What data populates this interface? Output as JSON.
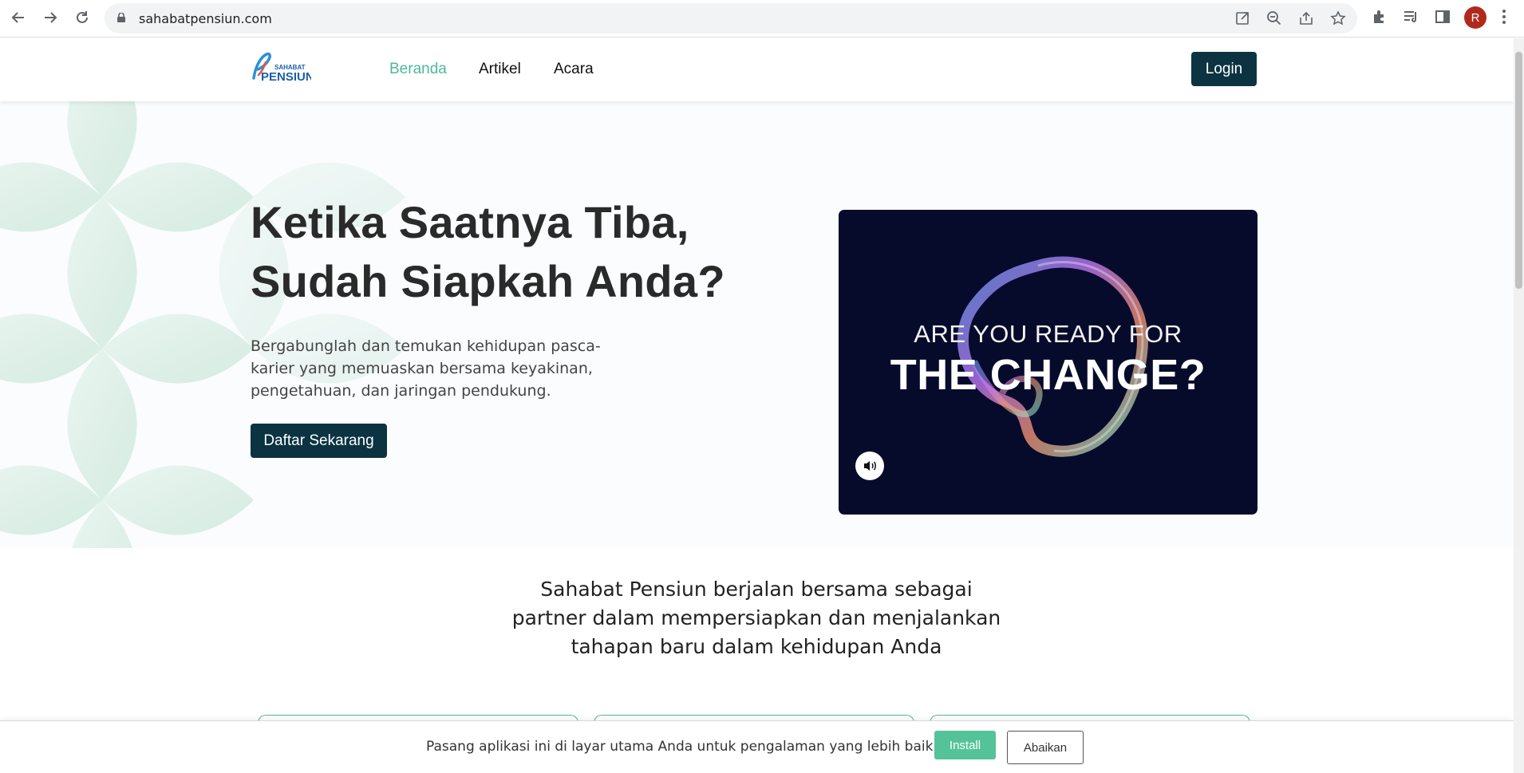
{
  "browser": {
    "url": "sahabatpensiun.com",
    "profile_initial": "R",
    "icons": [
      "back-arrow-icon",
      "forward-arrow-icon",
      "reload-icon",
      "lock-icon",
      "open-in-app-icon",
      "zoom-out-icon",
      "share-icon",
      "bookmark-star-icon",
      "extensions-puzzle-icon",
      "media-queue-icon",
      "side-panel-icon",
      "more-vert-icon"
    ]
  },
  "site": {
    "logo_text_top": "SAHABAT",
    "logo_text_bottom": "PENSIUN",
    "nav": [
      {
        "label": "Beranda",
        "active": true
      },
      {
        "label": "Artikel",
        "active": false
      },
      {
        "label": "Acara",
        "active": false
      }
    ],
    "login_label": "Login"
  },
  "hero": {
    "title_line1": "Ketika Saatnya Tiba,",
    "title_line2": "Sudah Siapkah Anda?",
    "desc_line1": "Bergabunglah dan temukan kehidupan pasca-",
    "desc_line2": "karier yang memuaskan bersama keyakinan,",
    "desc_line3": "pengetahuan, dan jaringan pendukung.",
    "cta_label": "Daftar Sekarang",
    "video_line1": "ARE YOU READY FOR",
    "video_line2": "THE CHANGE?",
    "video_sound_icon": "speaker-icon"
  },
  "partner": {
    "line1": "Sahabat Pensiun berjalan bersama sebagai",
    "line2": "partner dalam mempersiapkan dan menjalankan",
    "line3": "tahapan baru dalam kehidupan Anda"
  },
  "install_prompt": {
    "text": "Pasang aplikasi ini di layar utama Anda untuk pengalaman yang lebih baik.",
    "install_label": "Install",
    "dismiss_label": "Abaikan"
  },
  "colors": {
    "brand_dark": "#0b3342",
    "accent_green": "#4db89a",
    "video_bg": "#070b2b"
  }
}
